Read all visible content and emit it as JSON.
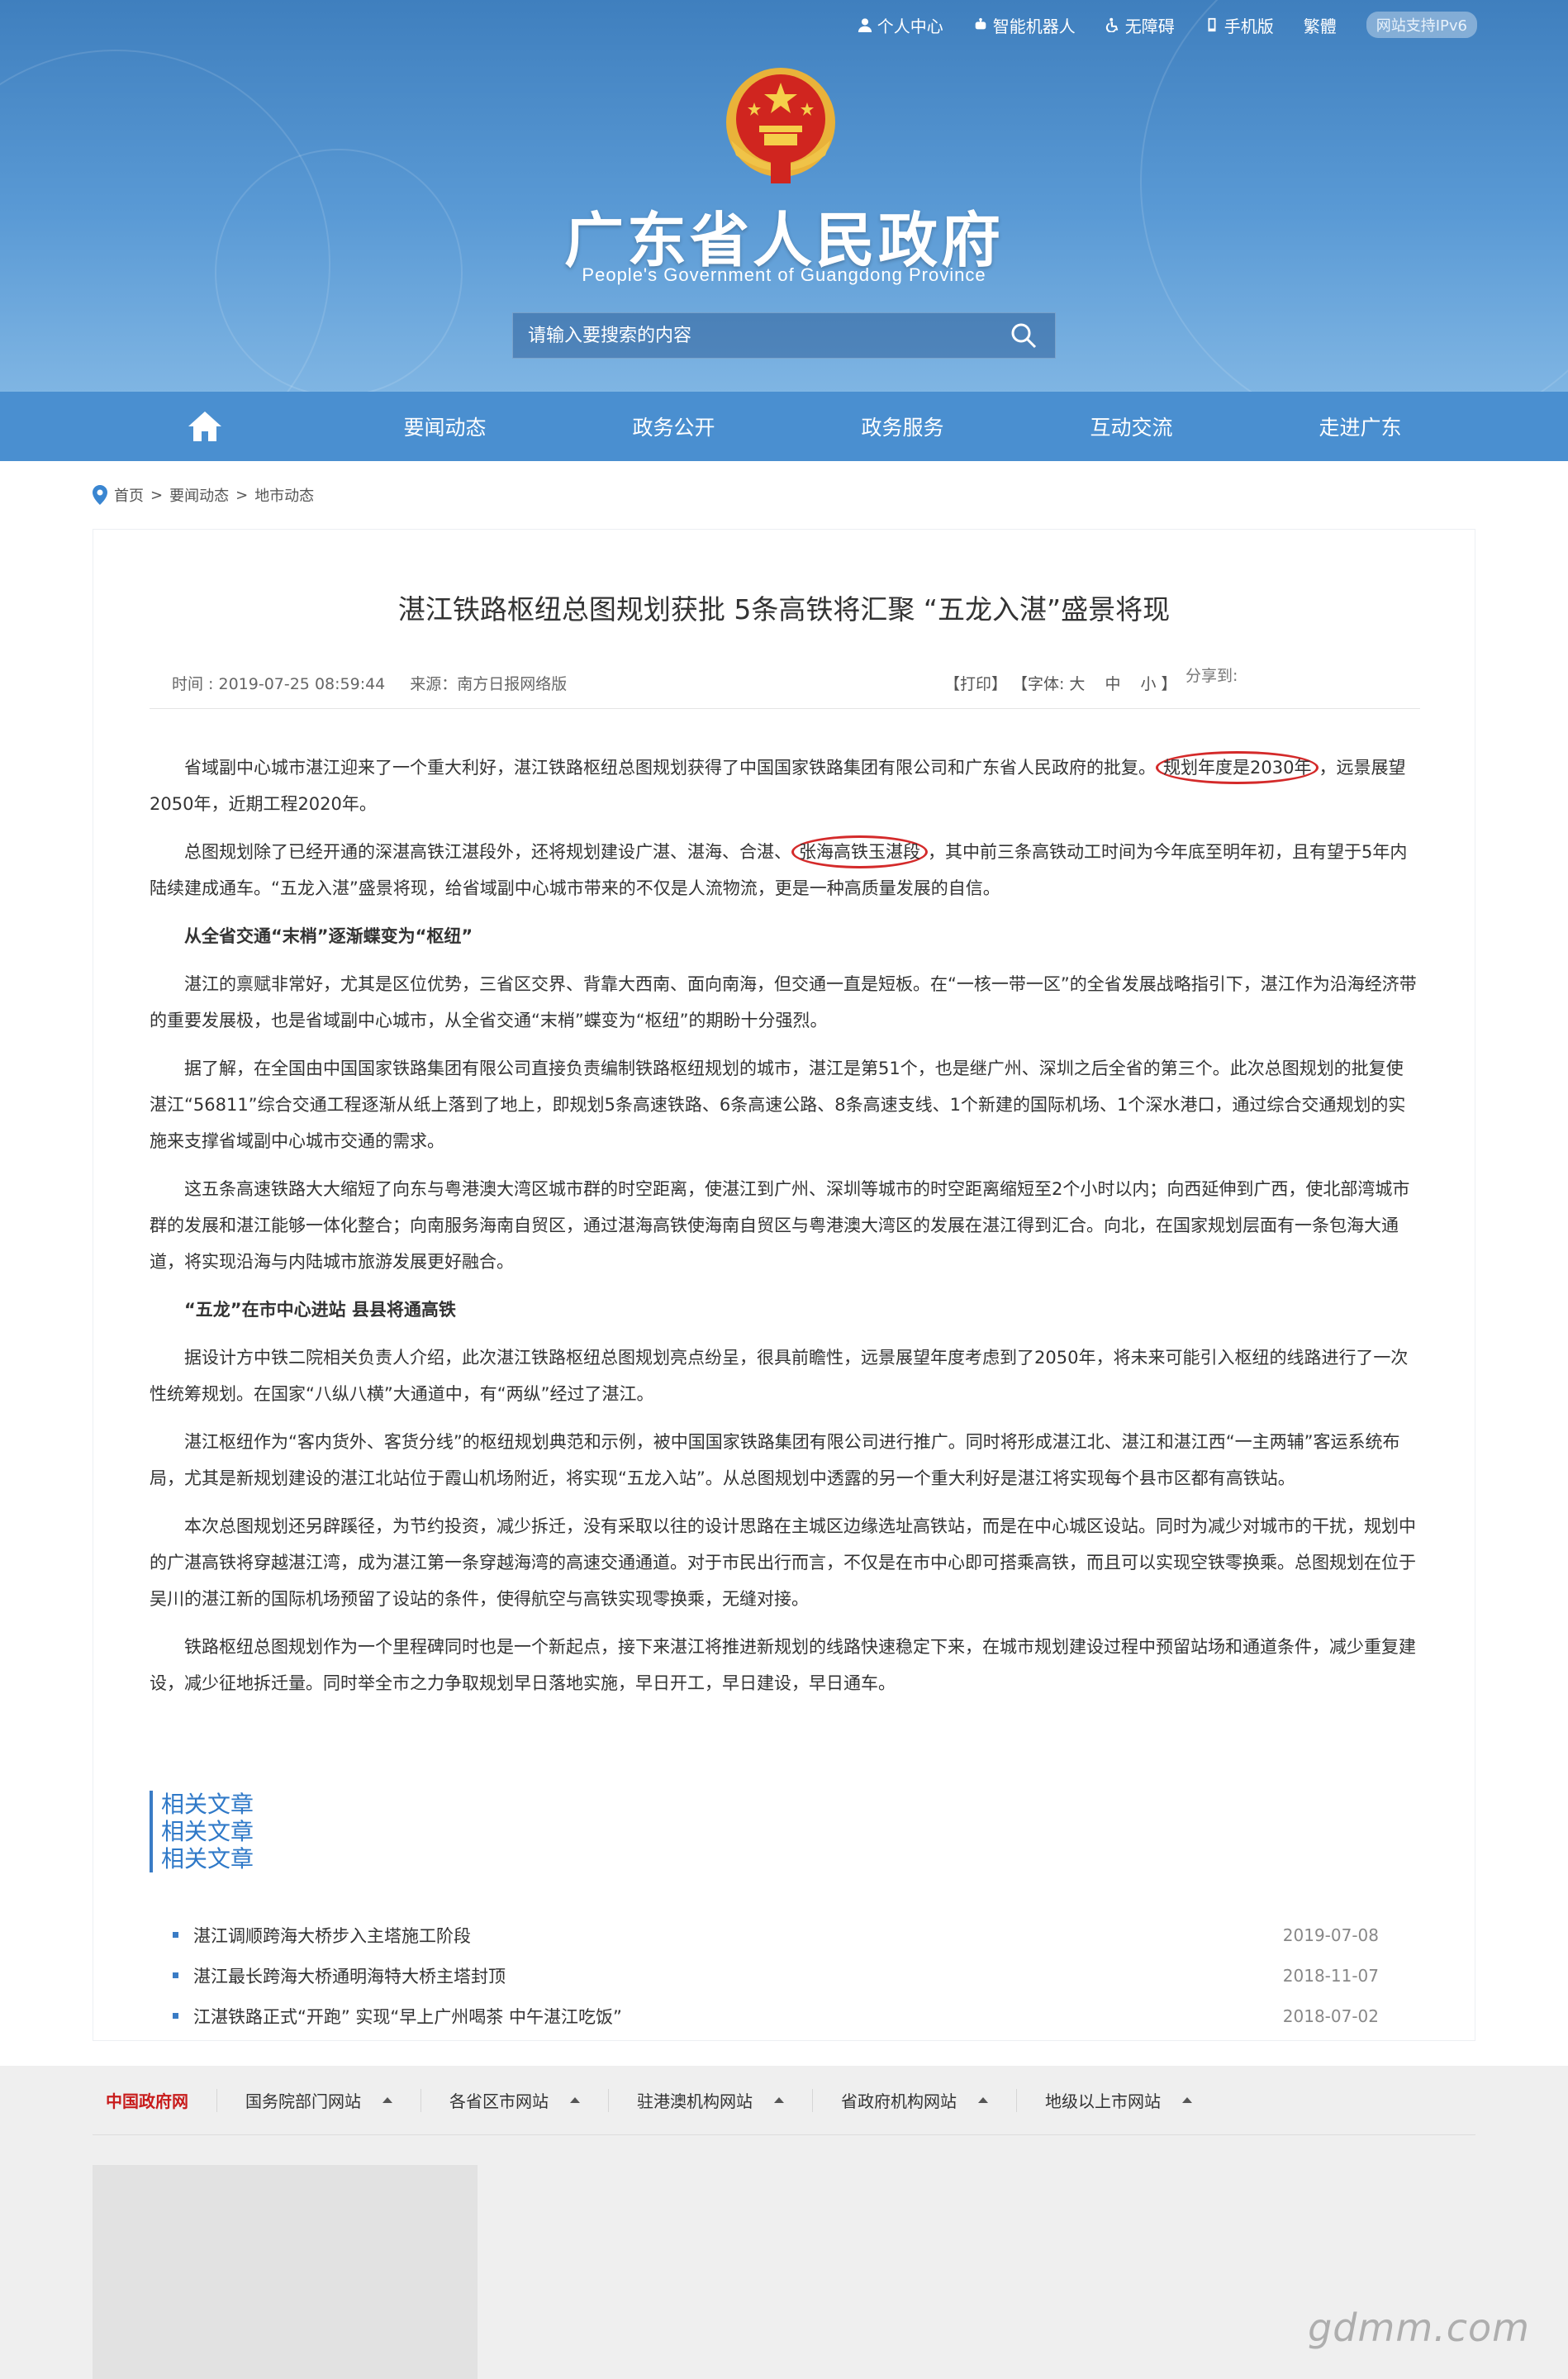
{
  "topbar": {
    "links": [
      {
        "label": "个人中心",
        "icon": "user-icon"
      },
      {
        "label": "智能机器人",
        "icon": "robot-icon"
      },
      {
        "label": "无障碍",
        "icon": "accessibility-icon"
      },
      {
        "label": "手机版",
        "icon": "phone-icon"
      },
      {
        "label": "繁體",
        "icon": ""
      }
    ],
    "ipv6_badge": "网站支持IPv6"
  },
  "header": {
    "title": "广东省人民政府",
    "subtitle": "People's Government of Guangdong Province",
    "emblem_icon": "national-emblem-icon"
  },
  "search": {
    "placeholder": "请输入要搜索的内容",
    "icon": "search-icon"
  },
  "nav": {
    "home_icon": "home-icon",
    "items": [
      "要闻动态",
      "政务公开",
      "政务服务",
      "互动交流",
      "走进广东"
    ]
  },
  "breadcrumb": {
    "icon": "location-pin-icon",
    "items": [
      "首页",
      "要闻动态",
      "地市动态"
    ],
    "separator": ">"
  },
  "article": {
    "title": "湛江铁路枢纽总图规划获批 5条高铁将汇聚 “五龙入湛”盛景将现",
    "time": "时间 : 2019-07-25 08:59:44",
    "source": "来源：南方日报网络版",
    "print": "【打印】",
    "font_label": "【字体:",
    "font_sizes": [
      "大",
      "中",
      "小"
    ],
    "font_end": "】",
    "share": "分享到:",
    "p1_a": "省域副中心城市湛江迎来了一个重大利好，湛江铁路枢纽总图规划获得了中国国家铁路集团有限公司和广东省人民政府的批复。",
    "p1_circle": "规划年度是2030年",
    "p1_b": "，远景展望2050年，近期工程2020年。",
    "p2_a": "总图规划除了已经开通的深湛高铁江湛段外，还将规划建设广湛、湛海、合湛、",
    "p2_circle": "张海高铁玉湛段",
    "p2_b": "，其中前三条高铁动工时间为今年底至明年初，且有望于5年内陆续建成通车。“五龙入湛”盛景将现，给省域副中心城市带来的不仅是人流物流，更是一种高质量发展的自信。",
    "h1": "从全省交通“末梢”逐渐蝶变为“枢纽”",
    "p3": "湛江的禀赋非常好，尤其是区位优势，三省区交界、背靠大西南、面向南海，但交通一直是短板。在“一核一带一区”的全省发展战略指引下，湛江作为沿海经济带的重要发展极，也是省域副中心城市，从全省交通“末梢”蝶变为“枢纽”的期盼十分强烈。",
    "p4": "据了解，在全国由中国国家铁路集团有限公司直接负责编制铁路枢纽规划的城市，湛江是第51个，也是继广州、深圳之后全省的第三个。此次总图规划的批复使湛江“56811”综合交通工程逐渐从纸上落到了地上，即规划5条高速铁路、6条高速公路、8条高速支线、1个新建的国际机场、1个深水港口，通过综合交通规划的实施来支撑省域副中心城市交通的需求。",
    "p5": "这五条高速铁路大大缩短了向东与粤港澳大湾区城市群的时空距离，使湛江到广州、深圳等城市的时空距离缩短至2个小时以内；向西延伸到广西，使北部湾城市群的发展和湛江能够一体化整合；向南服务海南自贸区，通过湛海高铁使海南自贸区与粤港澳大湾区的发展在湛江得到汇合。向北，在国家规划层面有一条包海大通道，将实现沿海与内陆城市旅游发展更好融合。",
    "h2": "“五龙”在市中心进站 县县将通高铁",
    "p6": "据设计方中铁二院相关负责人介绍，此次湛江铁路枢纽总图规划亮点纷呈，很具前瞻性，远景展望年度考虑到了2050年，将未来可能引入枢纽的线路进行了一次性统筹规划。在国家“八纵八横”大通道中，有“两纵”经过了湛江。",
    "p7": "湛江枢纽作为“客内货外、客货分线”的枢纽规划典范和示例，被中国国家铁路集团有限公司进行推广。同时将形成湛江北、湛江和湛江西“一主两辅”客运系统布局，尤其是新规划建设的湛江北站位于霞山机场附近，将实现“五龙入站”。从总图规划中透露的另一个重大利好是湛江将实现每个县市区都有高铁站。",
    "p8": "本次总图规划还另辟蹊径，为节约投资，减少拆迁，没有采取以往的设计思路在主城区边缘选址高铁站，而是在中心城区设站。同时为减少对城市的干扰，规划中的广湛高铁将穿越湛江湾，成为湛江第一条穿越海湾的高速交通通道。对于市民出行而言，不仅是在市中心即可搭乘高铁，而且可以实现空铁零换乘。总图规划在位于吴川的湛江新的国际机场预留了设站的条件，使得航空与高铁实现零换乘，无缝对接。",
    "p9": "铁路枢纽总图规划作为一个里程碑同时也是一个新起点，接下来湛江将推进新规划的线路快速稳定下来，在城市规划建设过程中预留站场和通道条件，减少重复建设，减少征地拆迁量。同时举全市之力争取规划早日落地实施，早日开工，早日建设，早日通车。",
    "annotation_color": "#d42a2a"
  },
  "related": {
    "heading_lines": [
      "相关文章",
      "相关文章",
      "相关文章"
    ],
    "items": [
      {
        "title": "湛江调顺跨海大桥步入主塔施工阶段",
        "date": "2019-07-08"
      },
      {
        "title": "湛江最长跨海大桥通明海特大桥主塔封顶",
        "date": "2018-11-07"
      },
      {
        "title": "江湛铁路正式“开跑” 实现“早上广州喝茶 中午湛江吃饭”",
        "date": "2018-07-02"
      }
    ]
  },
  "footer": {
    "links": [
      {
        "label": "中国政府网",
        "has_arrow": false
      },
      {
        "label": "国务院部门网站",
        "has_arrow": true
      },
      {
        "label": "各省区市网站",
        "has_arrow": true
      },
      {
        "label": "驻港澳机构网站",
        "has_arrow": true
      },
      {
        "label": "省政府机构网站",
        "has_arrow": true
      },
      {
        "label": "地级以上市网站",
        "has_arrow": true
      }
    ]
  },
  "watermark": "gdmm.com",
  "colors": {
    "banner": "#4a8fd0",
    "accent_link": "#2f79c8",
    "footer_red": "#c81c1c"
  }
}
